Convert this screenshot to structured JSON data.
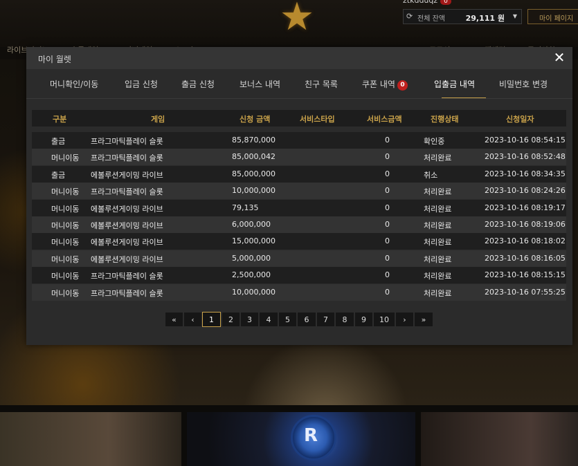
{
  "background": {
    "user_id": "ztkdduqz",
    "user_badge": "0",
    "balance_label": "전체 잔액",
    "balance_value": "29,111 원",
    "mypage_label": "마이 페이지",
    "nav_items": [
      "라이브카지노",
      "슬롯게임",
      "미니게임",
      "스포츠",
      "프로모션",
      "고객센터",
      "공지사항"
    ],
    "chip_text": "R"
  },
  "modal": {
    "title": "마이 월렛",
    "close_symbol": "✕",
    "tabs": [
      {
        "label": "머니확인/이동"
      },
      {
        "label": "입금 신청"
      },
      {
        "label": "출금 신청"
      },
      {
        "label": "보너스 내역"
      },
      {
        "label": "친구 목록"
      },
      {
        "label": "쿠폰 내역",
        "badge": "0"
      },
      {
        "label": "입출금 내역",
        "active": true
      },
      {
        "label": "비밀번호 변경"
      }
    ],
    "table": {
      "headers": [
        "구분",
        "게임",
        "신청 금액",
        "서비스타입",
        "서비스금액",
        "진행상태",
        "신청일자"
      ],
      "rows": [
        [
          "출금",
          "프라그마틱플레이 슬롯",
          "85,870,000",
          "",
          "0",
          "확인중",
          "2023-10-16 08:54:15"
        ],
        [
          "머니이동",
          "프라그마틱플레이 슬롯",
          "85,000,042",
          "",
          "0",
          "처리완료",
          "2023-10-16 08:52:48"
        ],
        [
          "출금",
          "에볼루션게이밍 라이브",
          "85,000,000",
          "",
          "0",
          "취소",
          "2023-10-16 08:34:35"
        ],
        [
          "머니이동",
          "프라그마틱플레이 슬롯",
          "10,000,000",
          "",
          "0",
          "처리완료",
          "2023-10-16 08:24:26"
        ],
        [
          "머니이동",
          "에볼루션게이밍 라이브",
          "79,135",
          "",
          "0",
          "처리완료",
          "2023-10-16 08:19:17"
        ],
        [
          "머니이동",
          "에볼루션게이밍 라이브",
          "6,000,000",
          "",
          "0",
          "처리완료",
          "2023-10-16 08:19:06"
        ],
        [
          "머니이동",
          "에볼루션게이밍 라이브",
          "15,000,000",
          "",
          "0",
          "처리완료",
          "2023-10-16 08:18:02"
        ],
        [
          "머니이동",
          "에볼루션게이밍 라이브",
          "5,000,000",
          "",
          "0",
          "처리완료",
          "2023-10-16 08:16:05"
        ],
        [
          "머니이동",
          "프라그마틱플레이 슬롯",
          "2,500,000",
          "",
          "0",
          "처리완료",
          "2023-10-16 08:15:15"
        ],
        [
          "머니이동",
          "프라그마틱플레이 슬롯",
          "10,000,000",
          "",
          "0",
          "처리완료",
          "2023-10-16 07:55:25"
        ]
      ]
    },
    "pagination": {
      "first": "«",
      "prev": "‹",
      "pages": [
        "1",
        "2",
        "3",
        "4",
        "5",
        "6",
        "7",
        "8",
        "9",
        "10"
      ],
      "current": "1",
      "next": "›",
      "last": "»"
    }
  },
  "colors": {
    "accent_gold": "#c9a24a",
    "badge_red": "#c0201e"
  }
}
